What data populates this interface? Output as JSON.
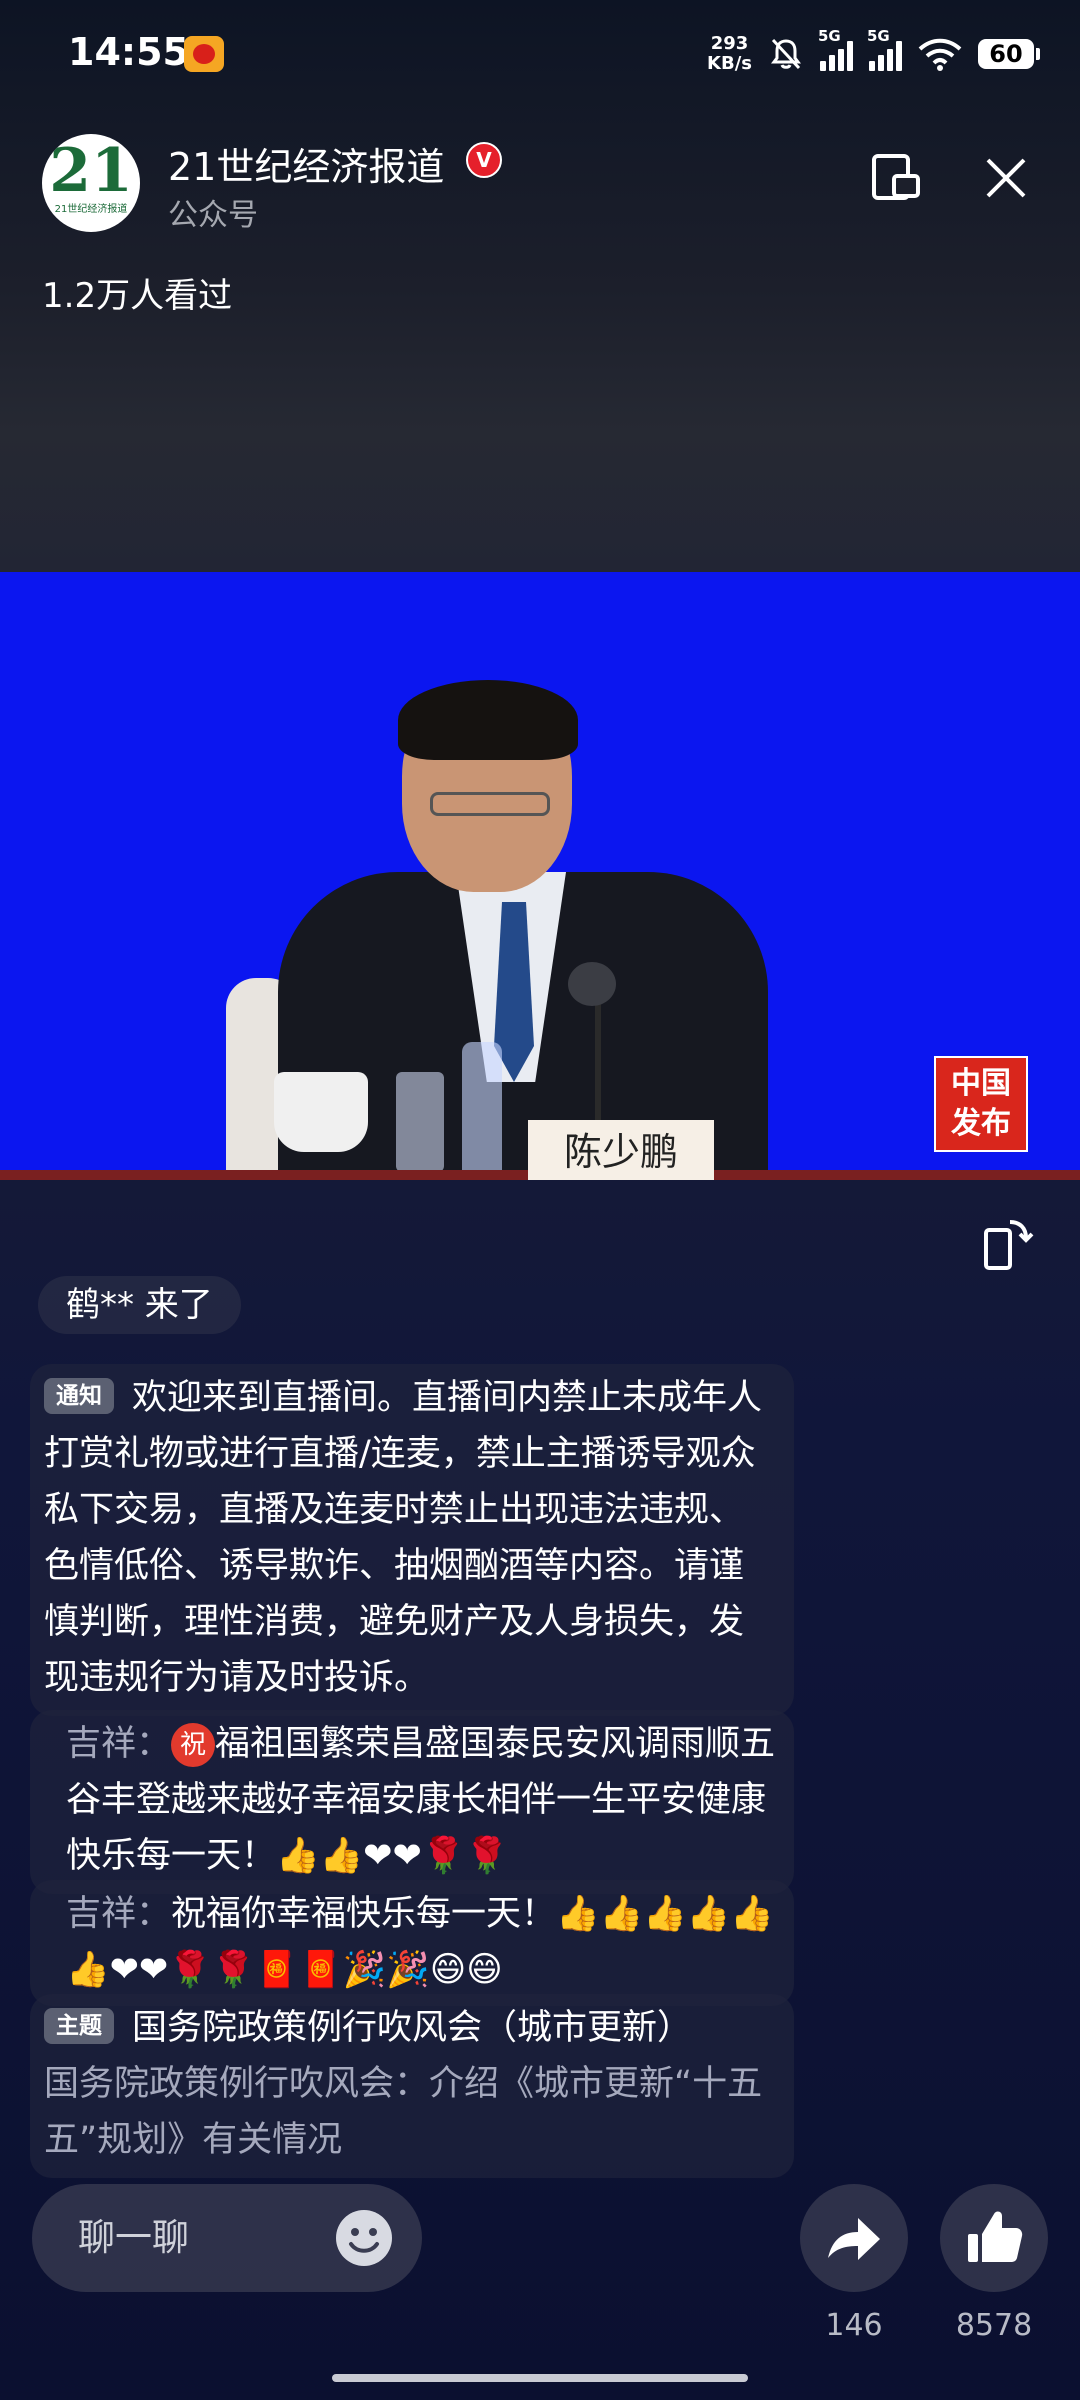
{
  "status_bar": {
    "time": "14:55",
    "net_speed_value": "293",
    "net_speed_unit": "KB/s",
    "signal1_label": "5G",
    "signal2_label": "5G",
    "battery": "60"
  },
  "header": {
    "avatar_text": "21",
    "avatar_subtext": "21世纪经济报道",
    "channel_name": "21世纪经济报道",
    "verified_badge": "V",
    "channel_type": "公众号",
    "viewers": "1.2万人看过"
  },
  "video": {
    "nameplate": "陈少鹏",
    "logo_line1": "中国",
    "logo_line2": "发布"
  },
  "chat": {
    "enter_notice": "鹤** 来了",
    "notice_tag": "通知",
    "notice_text": "欢迎来到直播间。直播间内禁止未成年人打赏礼物或进行直播/连麦，禁止主播诱导观众私下交易，直播及连麦时禁止出现违法违规、色情低俗、诱导欺诈、抽烟酗酒等内容。请谨慎判断，理性消费，避免财产及人身损失，发现违规行为请及时投诉。",
    "msg1_user": "吉祥：",
    "msg1_badge": "祝",
    "msg1_text": "福祖国繁荣昌盛国泰民安风调雨顺五谷丰登越来越好幸福安康长相伴一生平安健康快乐每一天！",
    "msg1_emojis": "👍👍❤❤🌹🌹",
    "msg2_user": "吉祥：",
    "msg2_text": "祝福你幸福快乐每一天！",
    "msg2_emojis": "👍👍👍👍👍👍❤❤🌹🌹🧧🧧🎉🎉😄😄",
    "topic_tag": "主题",
    "topic_title": "国务院政策例行吹风会（城市更新）",
    "topic_desc": "国务院政策例行吹风会：介绍《城市更新“十五五”规划》有关情况"
  },
  "bottom": {
    "input_placeholder": "聊一聊",
    "share_count": "146",
    "like_count": "8578"
  },
  "colors": {
    "video_background": "#0b16f0",
    "verified": "#e5202b",
    "tag_background": "#5b6072"
  }
}
